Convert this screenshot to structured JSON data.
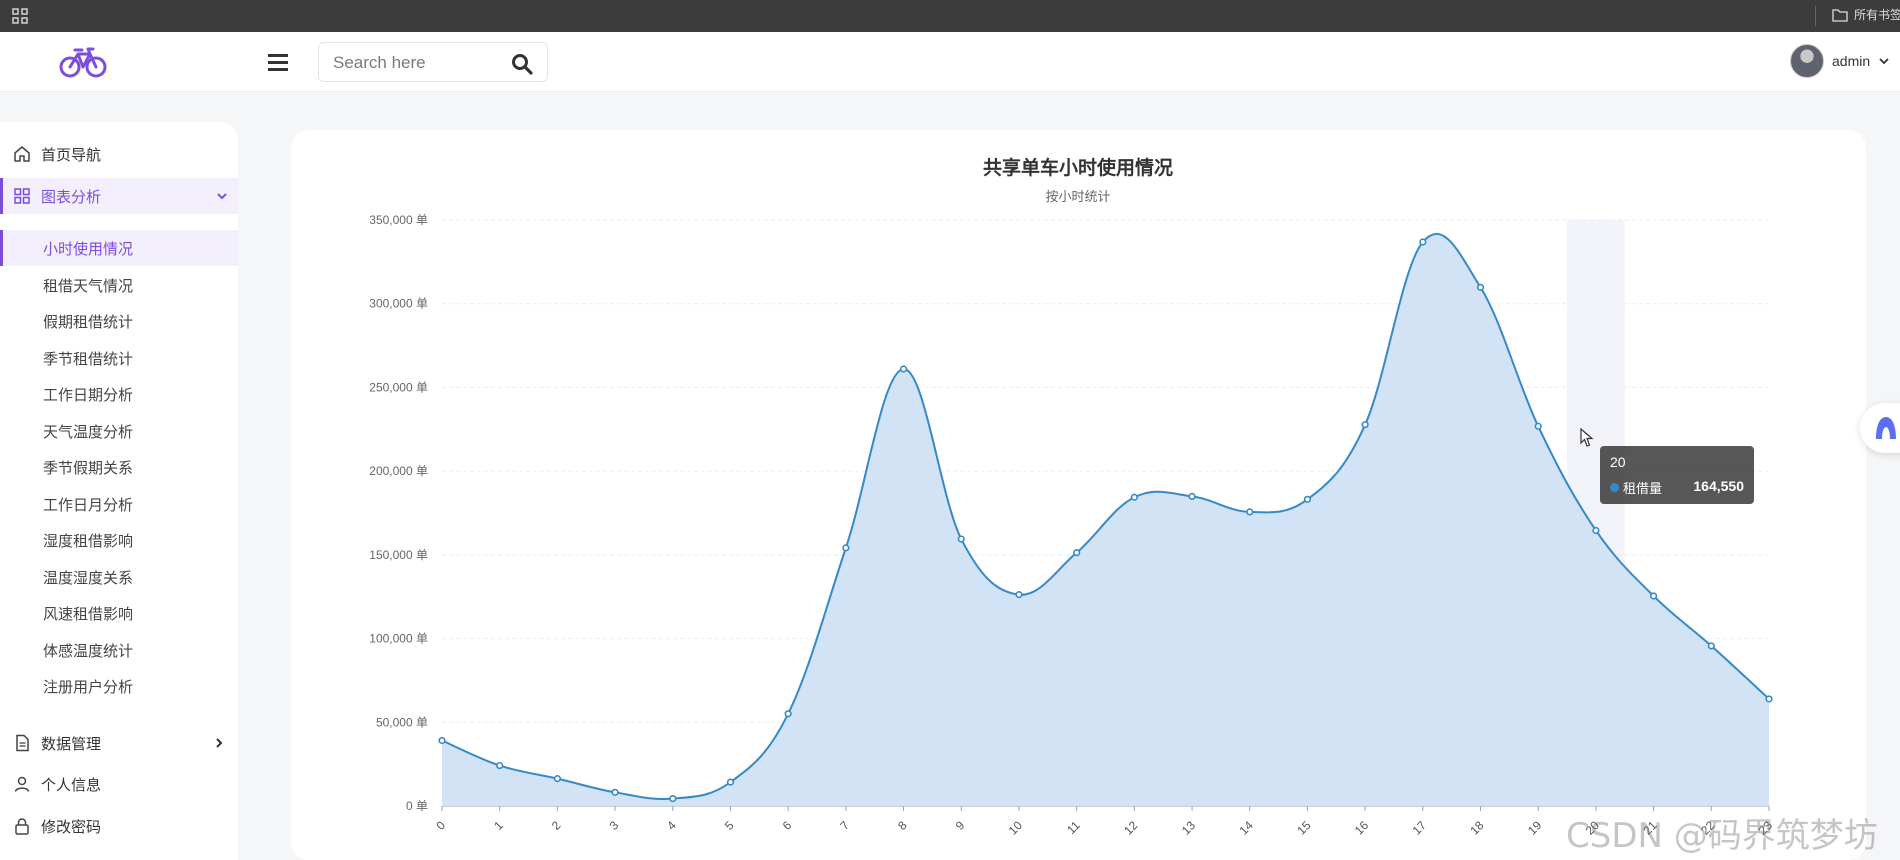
{
  "browser": {
    "bookmarks_folder": "所有书签"
  },
  "header": {
    "search_placeholder": "Search here",
    "user_name": "admin"
  },
  "sidebar": {
    "items": [
      {
        "label": "首页导航"
      },
      {
        "label": "图表分析"
      },
      {
        "label": "数据管理"
      },
      {
        "label": "个人信息"
      },
      {
        "label": "修改密码"
      }
    ],
    "sub_items": [
      {
        "label": "小时使用情况"
      },
      {
        "label": "租借天气情况"
      },
      {
        "label": "假期租借统计"
      },
      {
        "label": "季节租借统计"
      },
      {
        "label": "工作日期分析"
      },
      {
        "label": "天气温度分析"
      },
      {
        "label": "季节假期关系"
      },
      {
        "label": "工作日月分析"
      },
      {
        "label": "湿度租借影响"
      },
      {
        "label": "温度湿度关系"
      },
      {
        "label": "风速租借影响"
      },
      {
        "label": "体感温度统计"
      },
      {
        "label": "注册用户分析"
      }
    ]
  },
  "chart_data": {
    "type": "area",
    "title": "共享单车小时使用情况",
    "subtitle": "按小时统计",
    "xlabel": "",
    "ylabel": "",
    "y_unit_suffix": " 单",
    "ylim": [
      0,
      350000
    ],
    "y_ticks": [
      "0 单",
      "50,000 单",
      "100,000 单",
      "150,000 单",
      "200,000 单",
      "250,000 单",
      "300,000 单",
      "350,000 单"
    ],
    "categories": [
      "0",
      "1",
      "2",
      "3",
      "4",
      "5",
      "6",
      "7",
      "8",
      "9",
      "10",
      "11",
      "12",
      "13",
      "14",
      "15",
      "16",
      "17",
      "18",
      "19",
      "20",
      "21",
      "22",
      "23"
    ],
    "series": [
      {
        "name": "租借量",
        "values": [
          39130,
          24164,
          16352,
          8174,
          4428,
          14261,
          55132,
          154171,
          261001,
          159438,
          126257,
          151320,
          184414,
          184919,
          175652,
          183149,
          227748,
          336860,
          309772,
          226789,
          164550,
          125445,
          95612,
          63941
        ]
      }
    ],
    "grid": true,
    "colors": {
      "line": "#3689c9",
      "area": "#cfe2f3"
    },
    "tooltip": {
      "x": "20",
      "series": "租借量",
      "value": "164,550"
    }
  },
  "watermark": "CSDN @码界筑梦坊"
}
